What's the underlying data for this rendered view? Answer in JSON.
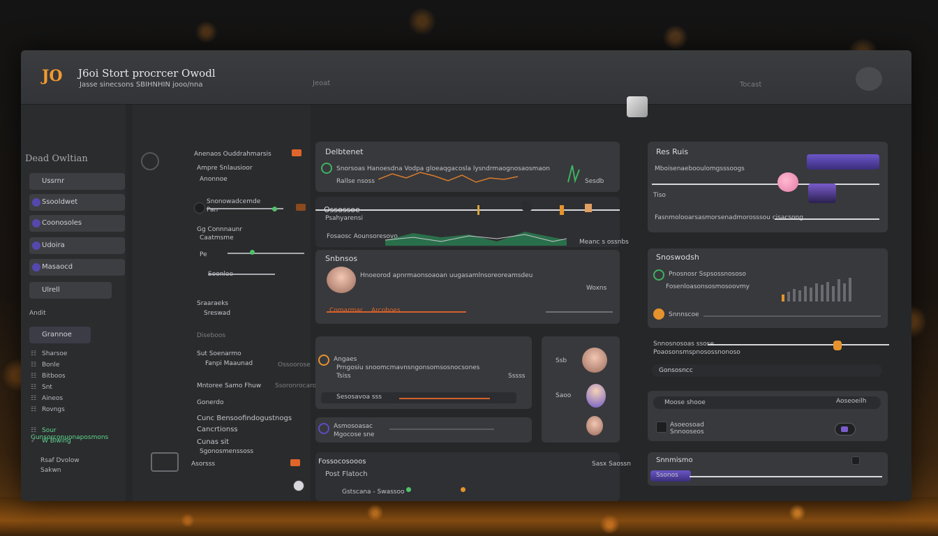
{
  "app": {
    "logo": "JO",
    "title": "J6oi Stort procrcer Owodl",
    "subtitle": "Jasse sinecsons SBIHNHIN jooo/nna",
    "center_text": "Jeoat",
    "right_text": "Tocast"
  },
  "sidebar": {
    "heading": "Dead Owltian",
    "items": [
      {
        "label": "Ussrnr"
      },
      {
        "label": "Ssooldwet"
      },
      {
        "label": "Coonosoles"
      },
      {
        "label": "Udoira"
      },
      {
        "label": "Masaocd"
      },
      {
        "label": "Ulrell"
      }
    ],
    "section_label": "Andit",
    "selected_item": "Grannoe",
    "sub_items": [
      {
        "icon": "☷",
        "label": "Sharsoe",
        "green": false
      },
      {
        "icon": "☷",
        "label": "Bonle",
        "green": false
      },
      {
        "icon": "☷",
        "label": "Bitboos",
        "green": false
      },
      {
        "icon": "☷",
        "label": "Snt",
        "green": false
      },
      {
        "icon": "☷",
        "label": "Aineos",
        "green": false
      },
      {
        "icon": "☷",
        "label": "Rovngs",
        "green": false
      },
      {
        "icon": "☷",
        "label": "Sour Gunsorconuonaposmons",
        "green": true
      },
      {
        "icon": "✓",
        "label": "W Biwing",
        "green": true
      }
    ],
    "footer_1": "Rsaf Dvolow",
    "footer_2": "Sakwn"
  },
  "col2": {
    "header": "Anenaos Ouddrahmarsis",
    "rows": [
      "Ampre Snlausioor",
      "Anonnoe",
      "Snonowadcemde",
      "Pan",
      "Gg Connnaunr",
      "Caatmsme",
      "Pe",
      "Soonlee",
      "Sraaraeks",
      "Sreswad",
      "Diseboos",
      "Sut Soenarmo",
      "Fanpi Maaunad",
      "Ossoorose",
      "Mntoree Samo Fhuw",
      "Ssoronrocaronon",
      "Gonerdo",
      "Cunc Bensoofindogustnogs",
      "Cancrtionss",
      "Cunas sit",
      "Sgonosmenssoss",
      "Asorsss"
    ]
  },
  "center": {
    "card1_title": "Delbtenet",
    "card1_line": "Snorsoas Hanoesdna Vodpa gloeaqgacosla lysndrmaognosaosmaon",
    "card1_sub": "Rallse nsoss",
    "card1_val": "Sesdb",
    "card2_title": "Ossossoe",
    "card2_sub": "Psahyarensi",
    "card2_foot": "Fosaosc Aounsoresovo",
    "card2_val": "Meanc s ossnbs",
    "card3_title": "Snbnsos",
    "card3_line": "Hnoeorod apnrmaonsoaoan uugasamlnsoreoreamsdeu",
    "card3_val": "Woxns",
    "card3_foot1": "Comarmar",
    "card3_foot2": "Arcoboes",
    "card4_line": "Prngosiu snoomcmavnsngonsomsosnocsones",
    "card4_title": "Angaes",
    "card4_sub": "Tsiss",
    "card4_val": "Sssss",
    "card4_foot": "Sesosavoa sss",
    "card5_line1": "Asmosoasac",
    "card5_line2": "Mgocose sne",
    "card6_val": "Ssb",
    "card6_val2": "Saoo",
    "bottom_title": "Fossocosooos",
    "bottom_sub": "Post Flatoch",
    "bottom_right": "Sasx Saossn",
    "bottom_foot": "Gstscana - Swassoo"
  },
  "right": {
    "card1_title": "Res Ruis",
    "card1_line": "Mboisenaebooulomgsssoogs",
    "card1_label": "Tiso",
    "card1_foot": "Fasnmolooarsasmorsenadmorosssou cisacsong",
    "card2_title": "Snoswodsh",
    "card2_line1": "Pnosnosr Sspsossnososo",
    "card2_line2": "Fosenloasonsosmosoovmy",
    "card2_foot": "Snnnscoe",
    "slider_label": "Snnosnosoas ssose",
    "slider_sub": "Poaosonsmspnosossnonoso",
    "pill1": "Gonsosncc",
    "pill2": "Moose shooe",
    "pill2_right": "Aoseoeilh",
    "foot_1": "Asoeosoad",
    "foot_2": "Snnooseos",
    "bottom_title": "Snnmismo",
    "bottom_text": "Ssonos"
  }
}
